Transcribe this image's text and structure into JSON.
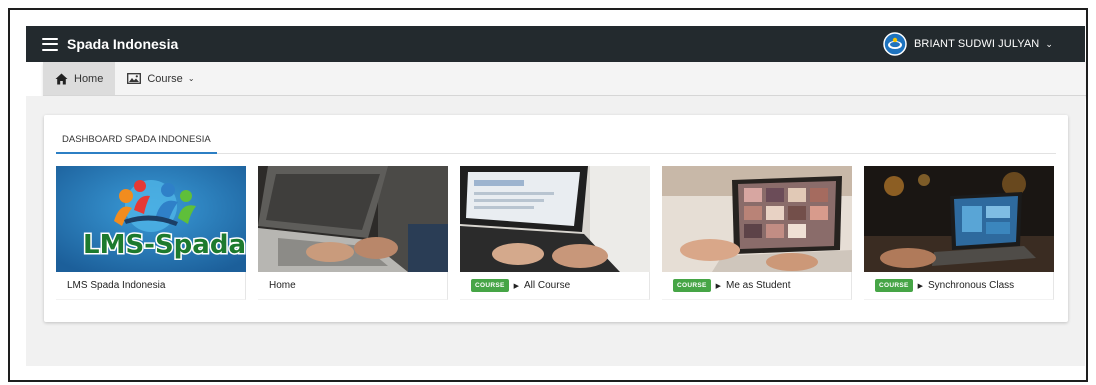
{
  "header": {
    "brand": "Spada Indonesia",
    "user_name": "BRIANT SUDWI JULYAN",
    "user_chevron": "⌄"
  },
  "nav": {
    "items": [
      {
        "label": "Home",
        "icon": "home-icon",
        "active": true
      },
      {
        "label": "Course",
        "icon": "image-icon",
        "dropdown": true
      }
    ]
  },
  "dashboard": {
    "tab_label": "DASHBOARD SPADA INDONESIA",
    "tiles": [
      {
        "title": "LMS Spada Indonesia",
        "logo_text": "LMS-Spada"
      },
      {
        "title": "Home"
      },
      {
        "title": "All Course",
        "badge": "COURSE"
      },
      {
        "title": "Me as Student",
        "badge": "COURSE"
      },
      {
        "title": "Synchronous Class",
        "badge": "COURSE"
      }
    ]
  },
  "colors": {
    "appbar": "#232a2e",
    "badge": "#46a546",
    "tab_accent": "#2c7fc4"
  }
}
